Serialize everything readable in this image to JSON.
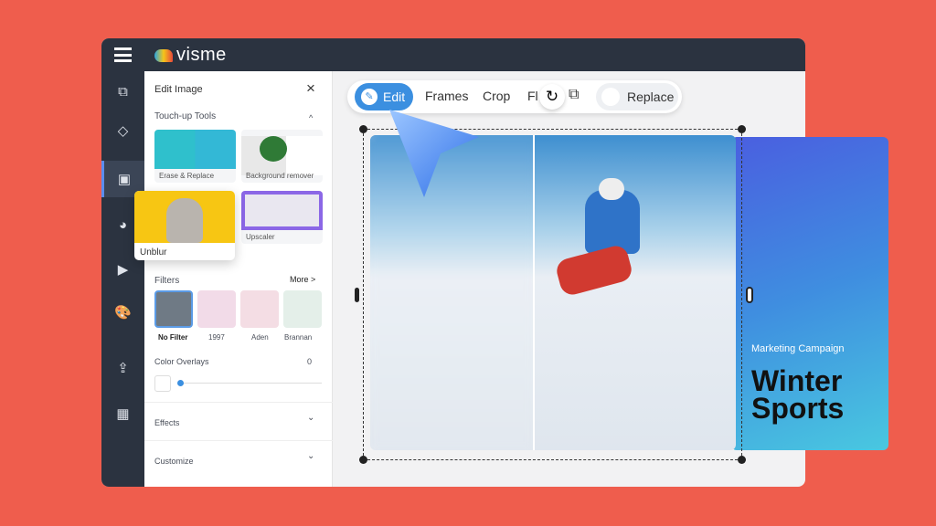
{
  "app": {
    "logo": "visme",
    "menu_icon": "hamburger-icon"
  },
  "sidebar": {
    "items": [
      "elements-icon",
      "shapes-icon",
      "image-icon",
      "chart-icon",
      "media-icon",
      "palette-icon",
      "upload-icon",
      "apps-icon"
    ]
  },
  "panel": {
    "title": "Edit Image",
    "close": "×",
    "touchup": {
      "label": "Touch-up Tools",
      "toggle": "^",
      "tools": [
        {
          "label": "Erase & Replace"
        },
        {
          "label": "Background remover"
        },
        {
          "label": "Unblur"
        },
        {
          "label": "Upscaler"
        }
      ]
    },
    "filters": {
      "label": "Filters",
      "more": "More >",
      "items": [
        "No Filter",
        "1997",
        "Aden",
        "Brannan"
      ]
    },
    "overlays": {
      "label": "Color Overlays",
      "value": "0",
      "slider": 0
    },
    "effects": "Effects",
    "customize": "Customize",
    "chevron": "⌄"
  },
  "toolbar": {
    "edit": "Edit",
    "frames": "Frames",
    "crop": "Crop",
    "flip": "Fl",
    "replace": "Replace"
  },
  "card": {
    "subtitle": "Marketing Campaign",
    "title_line1": "Winter",
    "title_line2": "Sports"
  },
  "colors": {
    "background": "#ef5d4d",
    "dark": "#2b3340",
    "accent": "#3b8fe0"
  }
}
